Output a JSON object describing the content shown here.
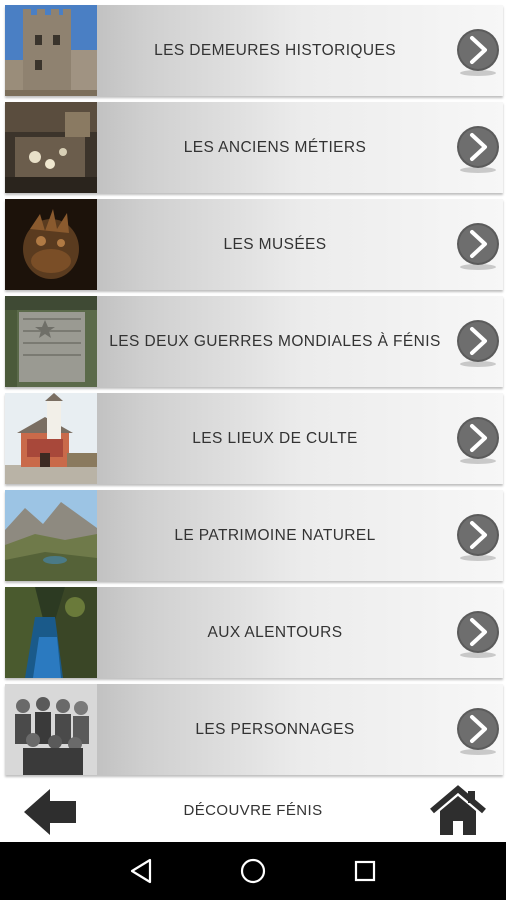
{
  "menu": {
    "items": [
      {
        "label": "LES DEMEURES HISTORIQUES",
        "thumb_icon": "castle-tower-photo"
      },
      {
        "label": "LES ANCIENS MÉTIERS",
        "thumb_icon": "workshop-interior-photo"
      },
      {
        "label": "LES MUSÉES",
        "thumb_icon": "wooden-sculpture-photo"
      },
      {
        "label": "LES DEUX GUERRES MONDIALES À FÉNIS",
        "thumb_icon": "stone-memorial-photo"
      },
      {
        "label": "LES LIEUX DE CULTE",
        "thumb_icon": "chapel-photo"
      },
      {
        "label": "LE PATRIMOINE NATUREL",
        "thumb_icon": "mountain-valley-photo"
      },
      {
        "label": "AUX ALENTOURS",
        "thumb_icon": "gorge-stream-photo"
      },
      {
        "label": "LES PERSONNAGES",
        "thumb_icon": "historic-group-photo"
      }
    ],
    "chevron_icon": "chevron-right-circle-icon"
  },
  "footer": {
    "title": "DÉCOUVRE FÉNIS",
    "back_icon": "back-arrow-icon",
    "home_icon": "home-icon"
  },
  "navbar": {
    "back_icon": "nav-back-triangle-icon",
    "home_icon": "nav-home-circle-icon",
    "recents_icon": "nav-recents-square-icon"
  },
  "colors": {
    "row_gradient_start": "#a8a8a8",
    "row_gradient_end": "#f7f7f7",
    "text": "#333333",
    "navbar": "#000000"
  }
}
